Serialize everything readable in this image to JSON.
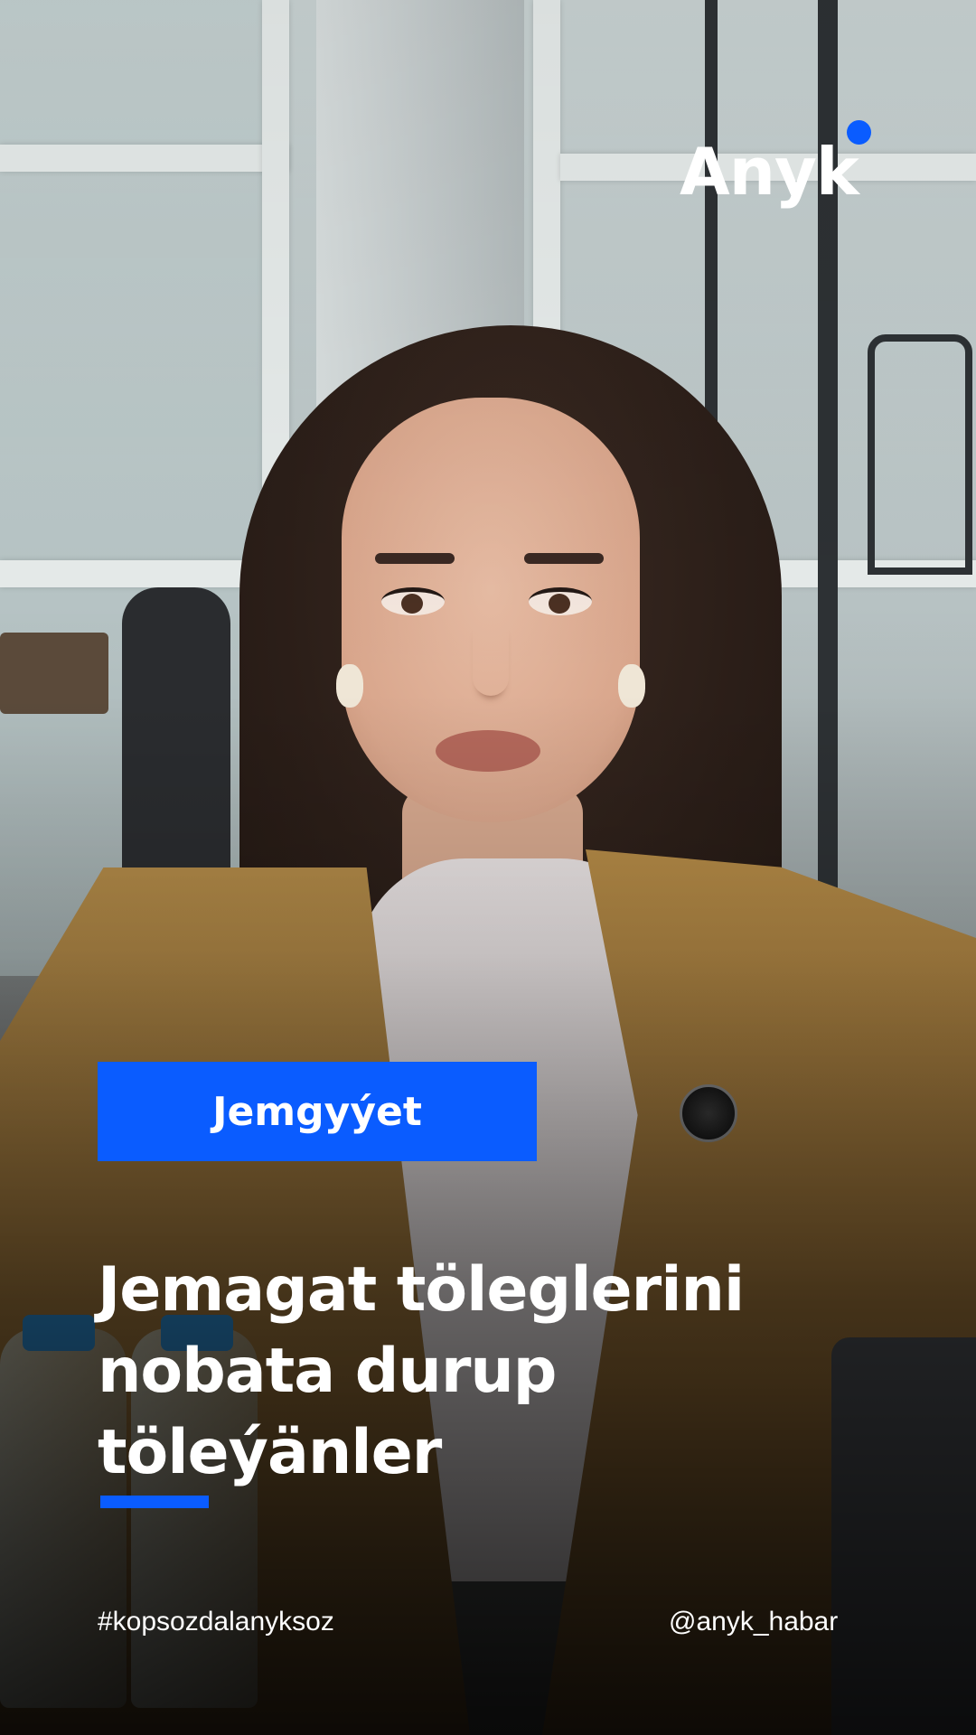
{
  "brand": {
    "name": "Anyk",
    "dot_color": "#0a5cff"
  },
  "category": {
    "label": "Jemgyýet",
    "color": "#0a5cff"
  },
  "headline": {
    "text": "Jemagat töleglerini nobata durup töleýänler"
  },
  "footer": {
    "hashtag": "#kopsozdalanyksoz",
    "handle": "@anyk_habar"
  },
  "photo": {
    "subject": "woman-in-office"
  }
}
